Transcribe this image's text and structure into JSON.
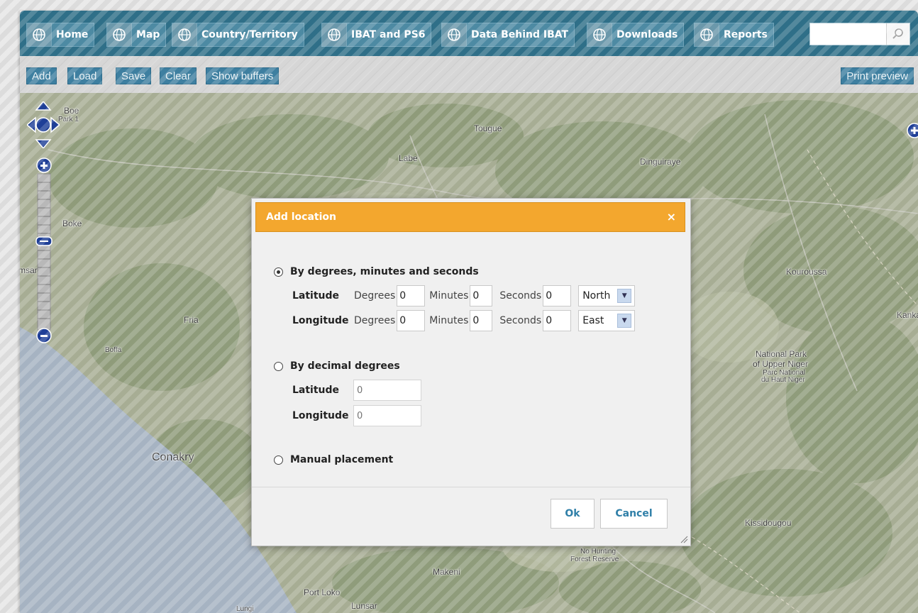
{
  "nav": {
    "items": [
      {
        "label": "Home"
      },
      {
        "label": "Map"
      },
      {
        "label": "Country/Territory"
      },
      {
        "label": "IBAT and PS6"
      },
      {
        "label": "Data Behind IBAT"
      },
      {
        "label": "Downloads"
      },
      {
        "label": "Reports"
      }
    ],
    "search_placeholder": "",
    "icon": "globe-icon"
  },
  "toolbar": {
    "add": "Add",
    "load": "Load",
    "save": "Save",
    "clear": "Clear",
    "show_buffers": "Show buffers",
    "print_preview": "Print preview"
  },
  "map": {
    "places": {
      "boe": "Boe",
      "park1": "Park 1",
      "tougue": "Tougue",
      "labe": "Labe",
      "dinguiraye": "Dinguiraye",
      "boke": "Boke",
      "msar": "msar",
      "kouroussa": "Kouroussa",
      "fria": "Fria",
      "kanka": "Kanka",
      "boffa": "Boffa",
      "np1": "National Park",
      "np2": "of Upper Niger",
      "np3": "Parc National",
      "np4": "du Haut Niger",
      "conakry": "Conakry",
      "kissidougou": "Kissidougou",
      "nh1": "No Hunting",
      "nh2": "Forest Reserve",
      "makeni": "Makeni",
      "portloko": "Port Loko",
      "lunsar": "Lunsar",
      "lungi": "Lungi"
    },
    "colors": {
      "land": "#a7ad94",
      "forest": "#8d9a78",
      "water": "#a6b3c2",
      "control": "#1f3f97"
    }
  },
  "dialog": {
    "title": "Add location",
    "close": "×",
    "dms": {
      "label": "By degrees, minutes and seconds",
      "checked": true,
      "latitude": "Latitude",
      "longitude": "Longitude",
      "degrees": "Degrees",
      "minutes": "Minutes",
      "seconds": "Seconds",
      "lat_deg": "0",
      "lat_min": "0",
      "lat_sec": "0",
      "lat_hemi": "North",
      "lon_deg": "0",
      "lon_min": "0",
      "lon_sec": "0",
      "lon_hemi": "East"
    },
    "decimal": {
      "label": "By decimal degrees",
      "latitude": "Latitude",
      "longitude": "Longitude",
      "lat_placeholder": "0",
      "lon_placeholder": "0"
    },
    "manual": {
      "label": "Manual placement"
    },
    "ok": "Ok",
    "cancel": "Cancel",
    "accent": "#f3a72e"
  }
}
